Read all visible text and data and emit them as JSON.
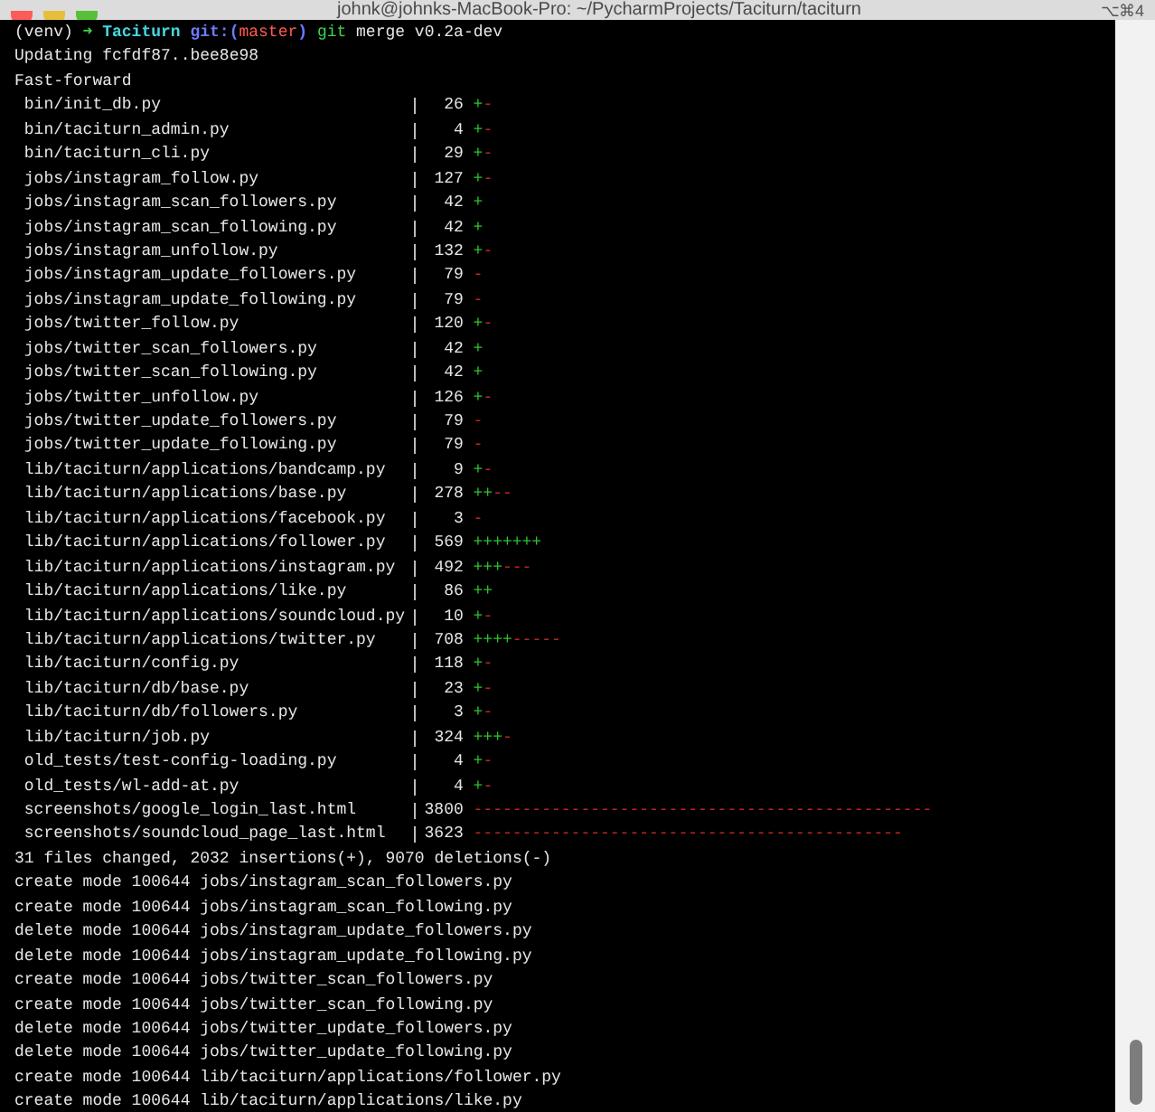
{
  "window": {
    "title": "johnk@johnks-MacBook-Pro: ~/PycharmProjects/Taciturn/taciturn",
    "shortcut": "⌥⌘4"
  },
  "prompt": {
    "env": "(venv)",
    "arrow": "➜",
    "directory": "Taciturn",
    "git_open": "git:(",
    "branch": "master",
    "git_close": ")",
    "command": "git",
    "arguments": "merge v0.2a-dev"
  },
  "output_lines": [
    "Updating fcfdf87..bee8e98",
    "Fast-forward"
  ],
  "diffstat": [
    {
      "file": "bin/init_db.py",
      "count": "26",
      "plus": "+",
      "minus": "-"
    },
    {
      "file": "bin/taciturn_admin.py",
      "count": "4",
      "plus": "+",
      "minus": "-"
    },
    {
      "file": "bin/taciturn_cli.py",
      "count": "29",
      "plus": "+",
      "minus": "-"
    },
    {
      "file": "jobs/instagram_follow.py",
      "count": "127",
      "plus": "+",
      "minus": "-"
    },
    {
      "file": "jobs/instagram_scan_followers.py",
      "count": "42",
      "plus": "+"
    },
    {
      "file": "jobs/instagram_scan_following.py",
      "count": "42",
      "plus": "+"
    },
    {
      "file": "jobs/instagram_unfollow.py",
      "count": "132",
      "plus": "+",
      "minus": "-"
    },
    {
      "file": "jobs/instagram_update_followers.py",
      "count": "79",
      "minus": "-"
    },
    {
      "file": "jobs/instagram_update_following.py",
      "count": "79",
      "minus": "-"
    },
    {
      "file": "jobs/twitter_follow.py",
      "count": "120",
      "plus": "+",
      "minus": "-"
    },
    {
      "file": "jobs/twitter_scan_followers.py",
      "count": "42",
      "plus": "+"
    },
    {
      "file": "jobs/twitter_scan_following.py",
      "count": "42",
      "plus": "+"
    },
    {
      "file": "jobs/twitter_unfollow.py",
      "count": "126",
      "plus": "+",
      "minus": "-"
    },
    {
      "file": "jobs/twitter_update_followers.py",
      "count": "79",
      "minus": "-"
    },
    {
      "file": "jobs/twitter_update_following.py",
      "count": "79",
      "minus": "-"
    },
    {
      "file": "lib/taciturn/applications/bandcamp.py",
      "count": "9",
      "plus": "+",
      "minus": "-"
    },
    {
      "file": "lib/taciturn/applications/base.py",
      "count": "278",
      "plus": "++",
      "minus": "--"
    },
    {
      "file": "lib/taciturn/applications/facebook.py",
      "count": "3",
      "minus": "-"
    },
    {
      "file": "lib/taciturn/applications/follower.py",
      "count": "569",
      "plus": "+++++++"
    },
    {
      "file": "lib/taciturn/applications/instagram.py",
      "count": "492",
      "plus": "+++",
      "minus": "---"
    },
    {
      "file": "lib/taciturn/applications/like.py",
      "count": "86",
      "plus": "++"
    },
    {
      "file": "lib/taciturn/applications/soundcloud.py",
      "count": "10",
      "plus": "+",
      "minus": "-"
    },
    {
      "file": "lib/taciturn/applications/twitter.py",
      "count": "708",
      "plus": "++++",
      "minus": "-----"
    },
    {
      "file": "lib/taciturn/config.py",
      "count": "118",
      "plus": "+",
      "minus": "-"
    },
    {
      "file": "lib/taciturn/db/base.py",
      "count": "23",
      "plus": "+",
      "minus": "-"
    },
    {
      "file": "lib/taciturn/db/followers.py",
      "count": "3",
      "plus": "+",
      "minus": "-"
    },
    {
      "file": "lib/taciturn/job.py",
      "count": "324",
      "plus": "+++",
      "minus": "-"
    },
    {
      "file": "old_tests/test-config-loading.py",
      "count": "4",
      "plus": "+",
      "minus": "-"
    },
    {
      "file": "old_tests/wl-add-at.py",
      "count": "4",
      "plus": "+",
      "minus": "-"
    },
    {
      "file": "screenshots/google_login_last.html",
      "count": "3800",
      "minus": "-----------------------------------------------"
    },
    {
      "file": "screenshots/soundcloud_page_last.html",
      "count": "3623",
      "minus": "--------------------------------------------"
    }
  ],
  "summary": "31 files changed, 2032 insertions(+), 9070 deletions(-)",
  "mode_lines": [
    "create mode 100644 jobs/instagram_scan_followers.py",
    "create mode 100644 jobs/instagram_scan_following.py",
    "delete mode 100644 jobs/instagram_update_followers.py",
    "delete mode 100644 jobs/instagram_update_following.py",
    "create mode 100644 jobs/twitter_scan_followers.py",
    "create mode 100644 jobs/twitter_scan_following.py",
    "delete mode 100644 jobs/twitter_update_followers.py",
    "delete mode 100644 jobs/twitter_update_following.py",
    "create mode 100644 lib/taciturn/applications/follower.py",
    "create mode 100644 lib/taciturn/applications/like.py"
  ]
}
